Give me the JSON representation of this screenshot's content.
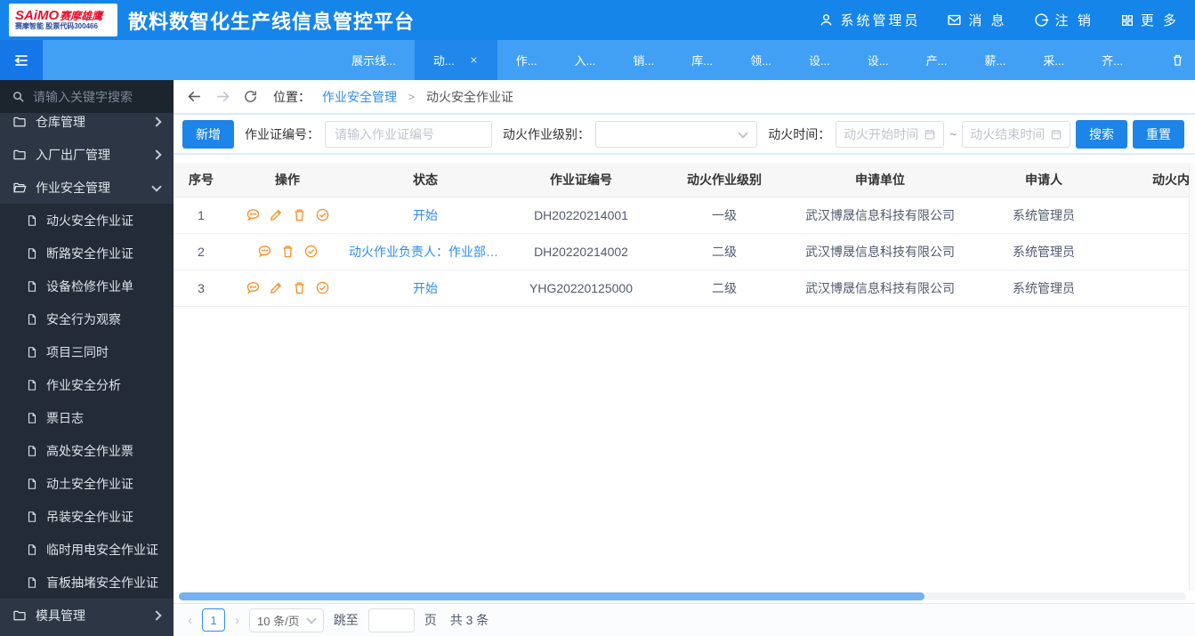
{
  "colors": {
    "header_blue": "#1585e9",
    "tabbar_blue": "#41a0f4",
    "active_tab_blue": "#2187ea",
    "hamburger_blue": "#1576e8",
    "sidebar_bg": "#2c3644",
    "sidebar_sub_bg": "#232b36",
    "sidebar_search_bg": "#1c242e",
    "accent_blue": "#1d84e8",
    "link_blue": "#2d8cf0",
    "icon_orange": "#f7912c",
    "separator_blue": "#d8ecfc"
  },
  "header": {
    "logo_main": "SAiMO",
    "logo_cn": "赛摩雄鹰",
    "logo_sub": "赛摩智能 股票代码300466",
    "title": "散料数智化生产线信息管控平台",
    "user": "系统管理员",
    "messages": "消 息",
    "logout": "注 销",
    "more": "更 多"
  },
  "tabs": {
    "items": [
      {
        "label": "展示线...",
        "active": false
      },
      {
        "label": "动...",
        "active": true,
        "closable": true
      },
      {
        "label": "作...",
        "active": false
      },
      {
        "label": "入...",
        "active": false
      },
      {
        "label": "销...",
        "active": false
      },
      {
        "label": "库...",
        "active": false
      },
      {
        "label": "领...",
        "active": false
      },
      {
        "label": "设...",
        "active": false
      },
      {
        "label": "设...",
        "active": false
      },
      {
        "label": "产...",
        "active": false
      },
      {
        "label": "薪...",
        "active": false
      },
      {
        "label": "采...",
        "active": false
      },
      {
        "label": "齐...",
        "active": false
      }
    ]
  },
  "sidebar": {
    "search_placeholder": "请输入关键字搜索",
    "menu": [
      {
        "label": "仓库管理",
        "expanded": false,
        "children": []
      },
      {
        "label": "入厂出厂管理",
        "expanded": false,
        "children": []
      },
      {
        "label": "作业安全管理",
        "expanded": true,
        "children": [
          "动火安全作业证",
          "断路安全作业证",
          "设备检修作业单",
          "安全行为观察",
          "项目三同时",
          "作业安全分析",
          "票日志",
          "高处安全作业票",
          "动土安全作业证",
          "吊装安全作业证",
          "临时用电安全作业证",
          "盲板抽堵安全作业证"
        ]
      },
      {
        "label": "模具管理",
        "expanded": false,
        "children": []
      }
    ]
  },
  "breadcrumb": {
    "prefix": "位置：",
    "parent": "作业安全管理",
    "separator": ">",
    "current": "动火安全作业证"
  },
  "filters": {
    "add_button": "新增",
    "cert_label": "作业证编号：",
    "cert_placeholder": "请输入作业证编号",
    "level_label": "动火作业级别：",
    "time_label": "动火时间：",
    "start_placeholder": "动火开始时间",
    "tilde": "~",
    "end_placeholder": "动火结束时间",
    "search_button": "搜索",
    "reset_button": "重置"
  },
  "table": {
    "columns": [
      "序号",
      "操作",
      "状态",
      "作业证编号",
      "动火作业级别",
      "申请单位",
      "申请人",
      "动火内"
    ],
    "rows": [
      {
        "seq": "1",
        "ops": [
          "comment",
          "edit",
          "delete",
          "approve"
        ],
        "status": "开始",
        "cert": "DH20220214001",
        "level": "一级",
        "unit": "武汉博晟信息科技有限公司",
        "applicant": "系统管理员"
      },
      {
        "seq": "2",
        "ops": [
          "comment",
          "delete",
          "approve"
        ],
        "status": "动火作业负责人：作业部门...",
        "cert": "DH20220214002",
        "level": "二级",
        "unit": "武汉博晟信息科技有限公司",
        "applicant": "系统管理员"
      },
      {
        "seq": "3",
        "ops": [
          "comment",
          "edit",
          "delete",
          "approve"
        ],
        "status": "开始",
        "cert": "YHG20220125000",
        "level": "二级",
        "unit": "武汉博晟信息科技有限公司",
        "applicant": "系统管理员"
      }
    ]
  },
  "pagination": {
    "prev": "‹",
    "page": "1",
    "next": "›",
    "page_size": "10 条/页",
    "jump_label": "跳至",
    "jump_suffix": "页",
    "total": "共 3 条"
  }
}
